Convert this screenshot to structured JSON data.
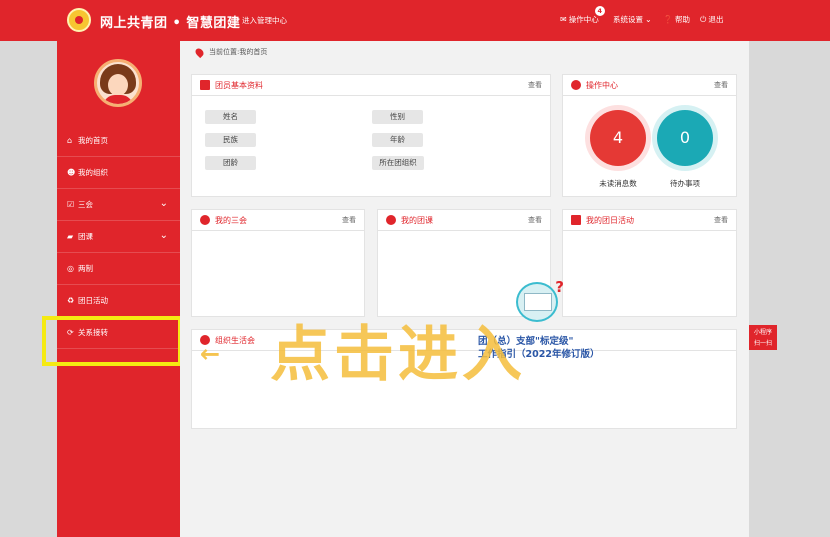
{
  "header": {
    "brand": "网上共青团 • 智慧团建",
    "manage_link": "进入管理中心",
    "nav": {
      "operation_center": "操作中心",
      "operation_badge": "4",
      "system_settings": "系统设置",
      "help": "帮助",
      "logout": "退出"
    }
  },
  "sidebar": {
    "items": [
      {
        "label": "我的首页",
        "icon": "home-icon"
      },
      {
        "label": "我的组织",
        "icon": "users-icon"
      },
      {
        "label": "三会",
        "icon": "checkbox-icon"
      },
      {
        "label": "团课",
        "icon": "folder-icon"
      },
      {
        "label": "两制",
        "icon": "target-icon"
      },
      {
        "label": "团日活动",
        "icon": "recycle-icon"
      },
      {
        "label": "关系接转",
        "icon": "refresh-icon"
      }
    ]
  },
  "breadcrumb": "当前位置:我的首页",
  "panels": {
    "member_info": {
      "title": "团员基本资料",
      "more": "查看",
      "fields": [
        "姓名",
        "性别",
        "民族",
        "年龄",
        "团龄",
        "所在团组织"
      ]
    },
    "operation": {
      "title": "操作中心",
      "more": "查看",
      "unread_count": "4",
      "unread_label": "未读消息数",
      "todo_count": "0",
      "todo_label": "待办事项"
    },
    "three_meetings": {
      "title": "我的三会",
      "more": "查看"
    },
    "league_class": {
      "title": "我的团课",
      "more": "查看"
    },
    "league_day": {
      "title": "我的团日活动",
      "more": "查看"
    },
    "org_life": {
      "title": "组织生活会"
    }
  },
  "overlay": {
    "notice_line1": "团（总）支部\"标定级\"",
    "notice_line2": "工作指引（2022年修订版）",
    "click_hint": "点击进入",
    "arrow": "←"
  },
  "side_widget": {
    "line1": "小程序",
    "line2": "扫一扫"
  },
  "colors": {
    "brand_red": "#e0252b",
    "unread_red": "#e53935",
    "todo_teal": "#1ba9b5",
    "highlight_yellow": "#f5ea12"
  }
}
